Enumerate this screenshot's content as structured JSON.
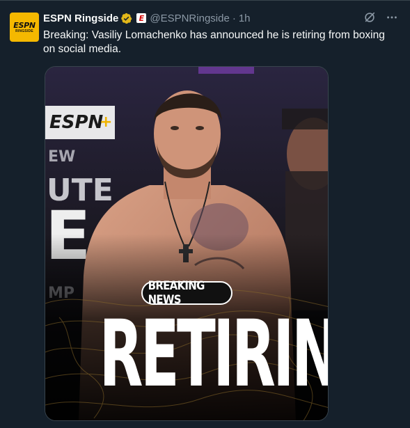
{
  "tweet": {
    "author_name": "ESPN Ringside",
    "handle": "@ESPNRingside",
    "separator": "·",
    "time": "1h",
    "text": "Breaking: Vasiliy Lomachenko has announced he is retiring from boxing on social media.",
    "avatar_logo": "ESPN",
    "avatar_sub": "RINGSIDE",
    "affiliate_mark": "E"
  },
  "media": {
    "badge_text": "BREAKING NEWS",
    "headline": "RETIRING",
    "background_sign": "ESPN+",
    "sign_letters": [
      "E",
      "W",
      "U",
      "T",
      "E",
      "E",
      "M",
      "P"
    ]
  },
  "colors": {
    "background": "#15202b",
    "secondary_text": "#8b98a5",
    "verified_gold": "#e2b719",
    "avatar_bg": "#f5b800"
  },
  "icons": [
    "verified-badge-icon",
    "grok-icon",
    "more-icon"
  ]
}
